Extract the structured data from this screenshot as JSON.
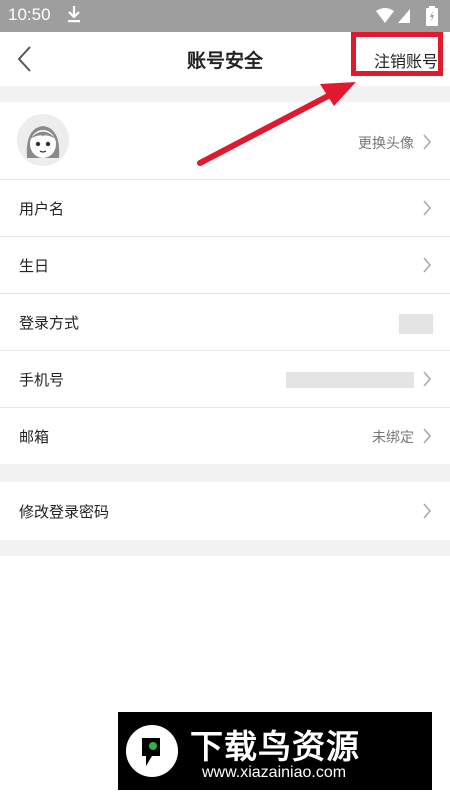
{
  "status": {
    "time": "10:50"
  },
  "nav": {
    "title": "账号安全",
    "right_action": "注销账号"
  },
  "rows": [
    {
      "label": "",
      "value": "更换头像"
    },
    {
      "label": "用户名",
      "value": ""
    },
    {
      "label": "生日",
      "value": ""
    },
    {
      "label": "登录方式",
      "value": ""
    },
    {
      "label": "手机号",
      "value": ""
    },
    {
      "label": "邮箱",
      "value": "未绑定"
    },
    {
      "label": "修改登录密码",
      "value": ""
    }
  ],
  "watermark": {
    "title": "下载鸟资源",
    "url": "www.xiazainiao.com"
  },
  "colors": {
    "highlight": "#e0192f",
    "status_bar": "#9e9e9e",
    "divider": "#f2f2f2"
  }
}
